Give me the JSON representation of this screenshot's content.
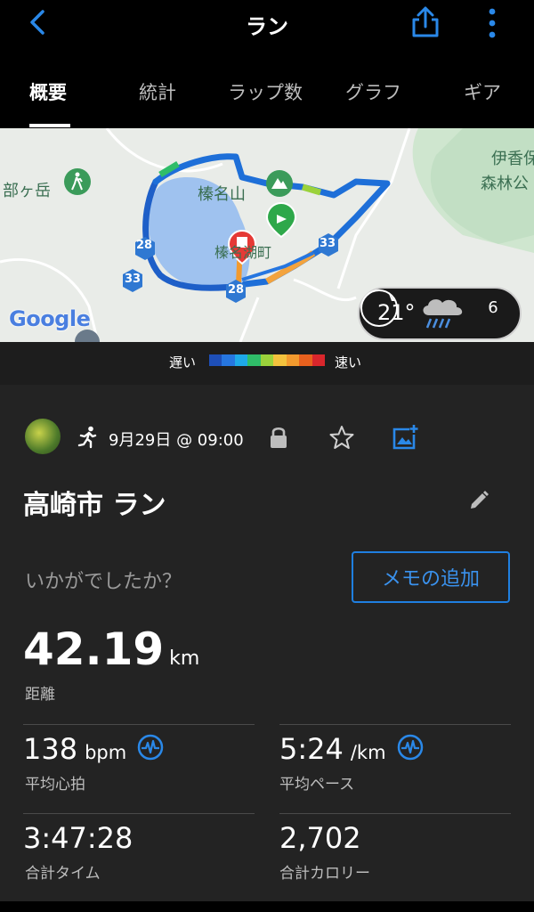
{
  "header": {
    "title": "ラン"
  },
  "tabs": [
    {
      "label": "概要",
      "active": true
    },
    {
      "label": "統計"
    },
    {
      "label": "ラップ数"
    },
    {
      "label": "グラフ"
    },
    {
      "label": "ギア"
    }
  ],
  "map": {
    "labels": {
      "mountain": "榛名山",
      "left": "部ヶ岳",
      "right_top": "伊香保",
      "right_mid": "森林公",
      "lake": "榛名湖町"
    },
    "route_numbers": [
      "28",
      "33",
      "33",
      "28"
    ],
    "attribution": "Google",
    "weather": {
      "temperature": "21°",
      "wind_speed": "6"
    }
  },
  "pace_legend": {
    "slow_label": "遅い",
    "fast_label": "速い",
    "colors": [
      "#1e4fb8",
      "#2676e0",
      "#1ea9e8",
      "#2fbd69",
      "#9bd23b",
      "#f3c23d",
      "#f29a2e",
      "#e8611e",
      "#d9262c"
    ]
  },
  "activity": {
    "date": "9月29日 @ 09:00",
    "title": "高崎市 ラン",
    "prompt": "いかがでしたか？",
    "memo_button": "メモの追加",
    "distance": {
      "value": "42.19",
      "unit": "km",
      "label": "距離"
    },
    "stats": [
      {
        "value": "138",
        "unit": "bpm",
        "label": "平均心拍"
      },
      {
        "value": "5:24",
        "unit": "/km",
        "label": "平均ペース"
      },
      {
        "value": "3:47:28",
        "unit": "",
        "label": "合計タイム"
      },
      {
        "value": "2,702",
        "unit": "",
        "label": "合計カロリー"
      }
    ]
  },
  "colors": {
    "accent": "#2a88e8",
    "background": "#000000",
    "card": "#232323"
  }
}
